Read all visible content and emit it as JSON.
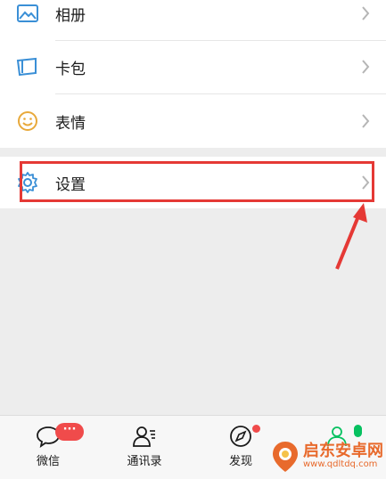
{
  "menu": {
    "items": [
      {
        "label": "相册",
        "icon": "photo-album-icon"
      },
      {
        "label": "卡包",
        "icon": "card-wallet-icon"
      },
      {
        "label": "表情",
        "icon": "sticker-smile-icon"
      }
    ],
    "settings": {
      "label": "设置",
      "icon": "gear-icon"
    }
  },
  "tabbar": {
    "tabs": [
      {
        "label": "微信",
        "icon": "chat-bubble-icon",
        "badge": "···"
      },
      {
        "label": "通讯录",
        "icon": "contacts-icon"
      },
      {
        "label": "发现",
        "icon": "compass-icon"
      },
      {
        "label": "",
        "icon": "me-icon"
      }
    ]
  },
  "watermark": {
    "title": "启东安卓网",
    "url": "www.qdltdq.com"
  },
  "colors": {
    "accent": "#07c160",
    "highlight": "#e53935",
    "badge": "#f04b4b",
    "icon_blue": "#3a8fd6"
  }
}
